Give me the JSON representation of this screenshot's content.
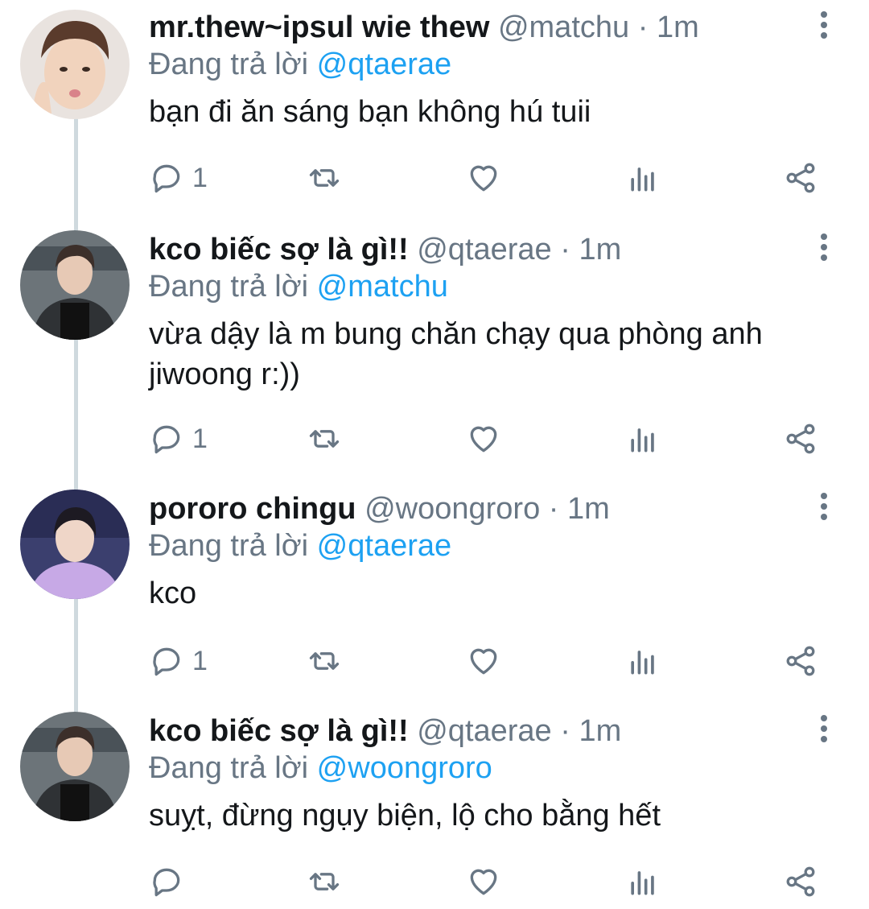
{
  "tweets": [
    {
      "name": "mr.thew~ipsul wie thew",
      "handle": "@matchu",
      "sep": " · ",
      "time": "1m",
      "reply_prefix": "Đang trả lời ",
      "reply_to": "@qtaerae",
      "text": "bạn đi ăn sáng bạn không hú tuii",
      "reply_count": "1",
      "avatar": "avatar-matchu"
    },
    {
      "name": "kco biếc sợ là gì!!",
      "handle": "@qtaerae",
      "sep": " · ",
      "time": "1m",
      "reply_prefix": "Đang trả lời ",
      "reply_to": "@matchu",
      "text": "vừa dậy là m bung chăn chạy qua phòng anh jiwoong r:))",
      "reply_count": "1",
      "avatar": "avatar-qtaerae"
    },
    {
      "name": "pororo chingu",
      "handle": "@woongroro",
      "sep": " · ",
      "time": "1m",
      "reply_prefix": "Đang trả lời ",
      "reply_to": "@qtaerae",
      "text": "kco",
      "reply_count": "1",
      "avatar": "avatar-woongroro"
    },
    {
      "name": "kco biếc sợ là gì!!",
      "handle": "@qtaerae",
      "sep": " · ",
      "time": "1m",
      "reply_prefix": "Đang trả lời ",
      "reply_to": "@woongroro",
      "text": "suỵt, đừng ngụy biện, lộ cho bằng hết",
      "reply_count": "",
      "avatar": "avatar-qtaerae"
    }
  ],
  "colors": {
    "accent": "#1da1f2",
    "muted": "#687684",
    "text": "#14171a",
    "thread_line": "#cfd9de"
  },
  "icons": [
    "reply-icon",
    "retweet-icon",
    "like-icon",
    "analytics-icon",
    "share-icon",
    "more-options-icon"
  ]
}
